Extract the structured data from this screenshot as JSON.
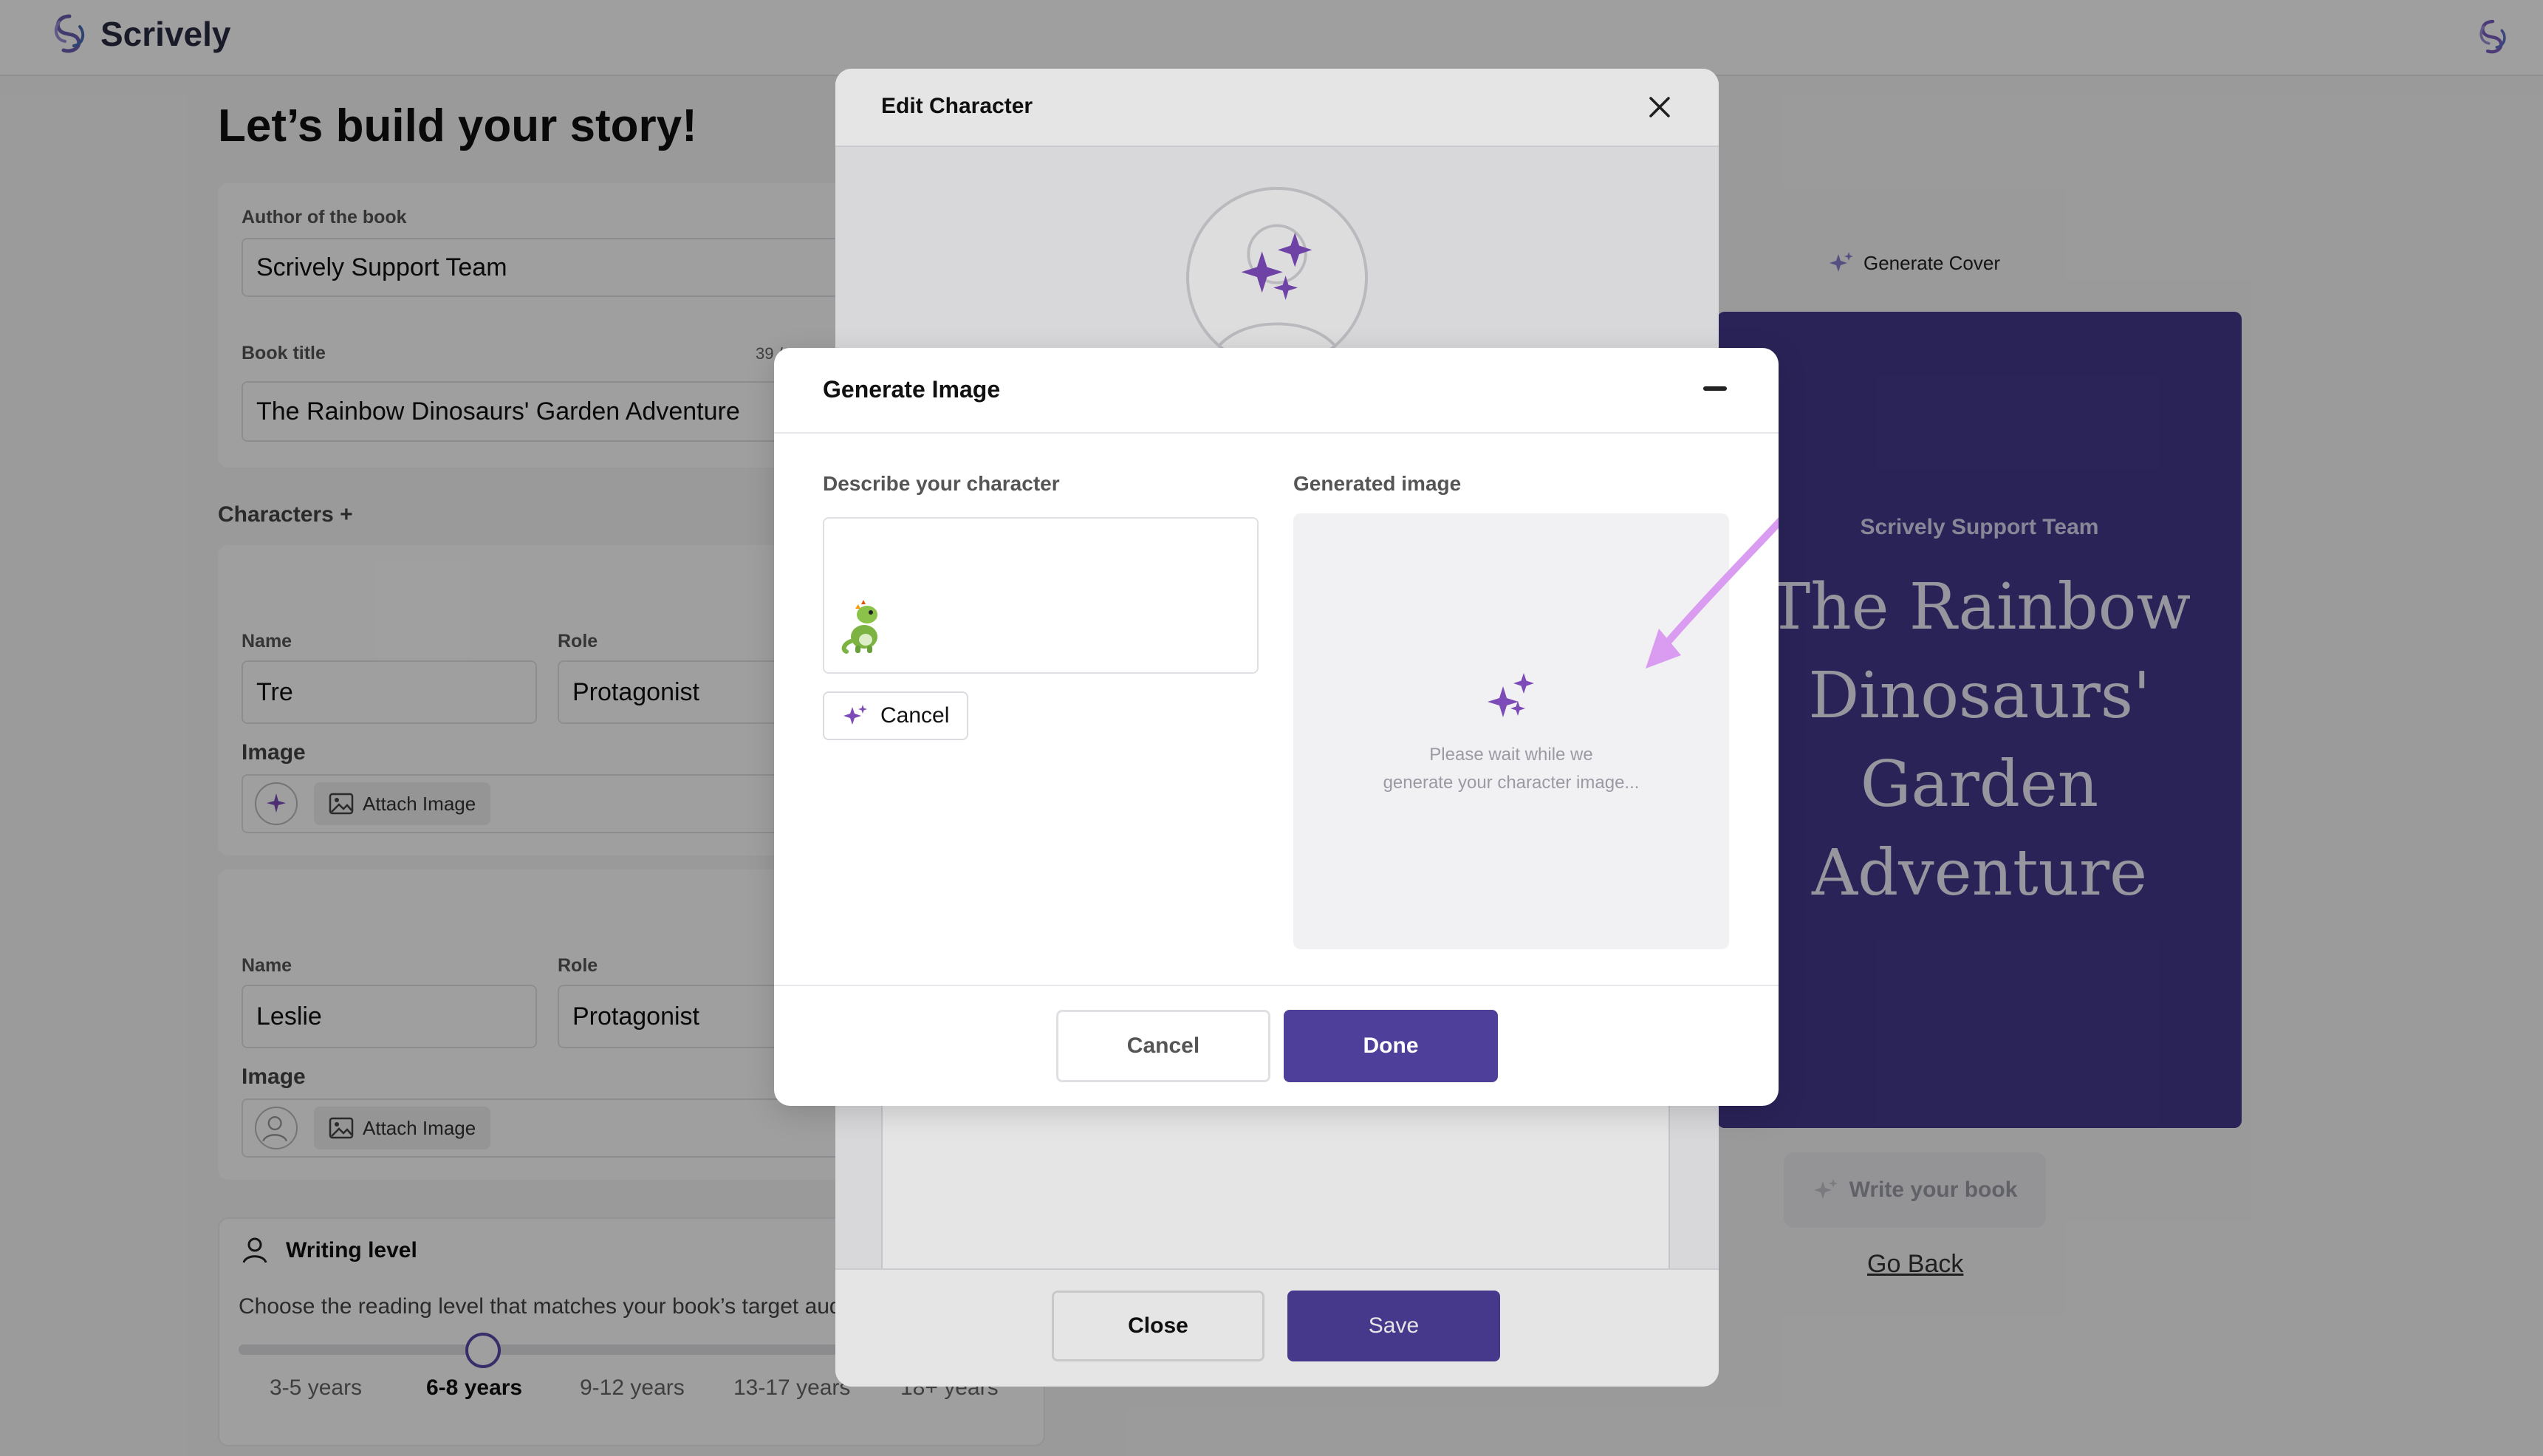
{
  "app": {
    "name": "Scrively"
  },
  "page": {
    "title": "Let’s build your story!"
  },
  "author": {
    "label": "Author of the book",
    "value": "Scrively Support Team"
  },
  "book": {
    "label": "Book title",
    "counter": "39 /",
    "value": "The Rainbow Dinosaurs' Garden Adventure"
  },
  "characters": {
    "label": "Characters +",
    "items": [
      {
        "name_label": "Name",
        "name": "Tre",
        "role_label": "Role",
        "role": "Protagonist",
        "image_label": "Image",
        "attach_label": "Attach Image"
      },
      {
        "name_label": "Name",
        "name": "Leslie",
        "role_label": "Role",
        "role": "Protagonist",
        "image_label": "Image",
        "attach_label": "Attach Image"
      }
    ]
  },
  "writing": {
    "title": "Writing level",
    "description": "Choose the reading level that matches your book’s target aud",
    "levels": [
      "3-5 years",
      "6-8 years",
      "9-12 years",
      "13-17 years",
      "18+ years"
    ],
    "selected": "6-8 years"
  },
  "cover": {
    "generate_label": "Generate Cover",
    "author": "Scrively Support Team",
    "title": "The Rainbow Dinosaurs' Garden Adventure"
  },
  "actions": {
    "write_label": "Write your book",
    "go_back_label": "Go Back"
  },
  "edit_modal": {
    "title": "Edit Character",
    "close_label": "Close",
    "save_label": "Save"
  },
  "generate_modal": {
    "title": "Generate Image",
    "describe_label": "Describe your character",
    "generated_label": "Generated image",
    "cancel_small_label": "Cancel",
    "wait_text_line1": "Please wait while we",
    "wait_text_line2": "generate your character image...",
    "cancel_label": "Cancel",
    "done_label": "Done"
  },
  "colors": {
    "accent": "#4e3f9a",
    "cover_bg": "#443a8e",
    "sparkle": "#7c4bb8",
    "arrow": "#d99cf0"
  }
}
